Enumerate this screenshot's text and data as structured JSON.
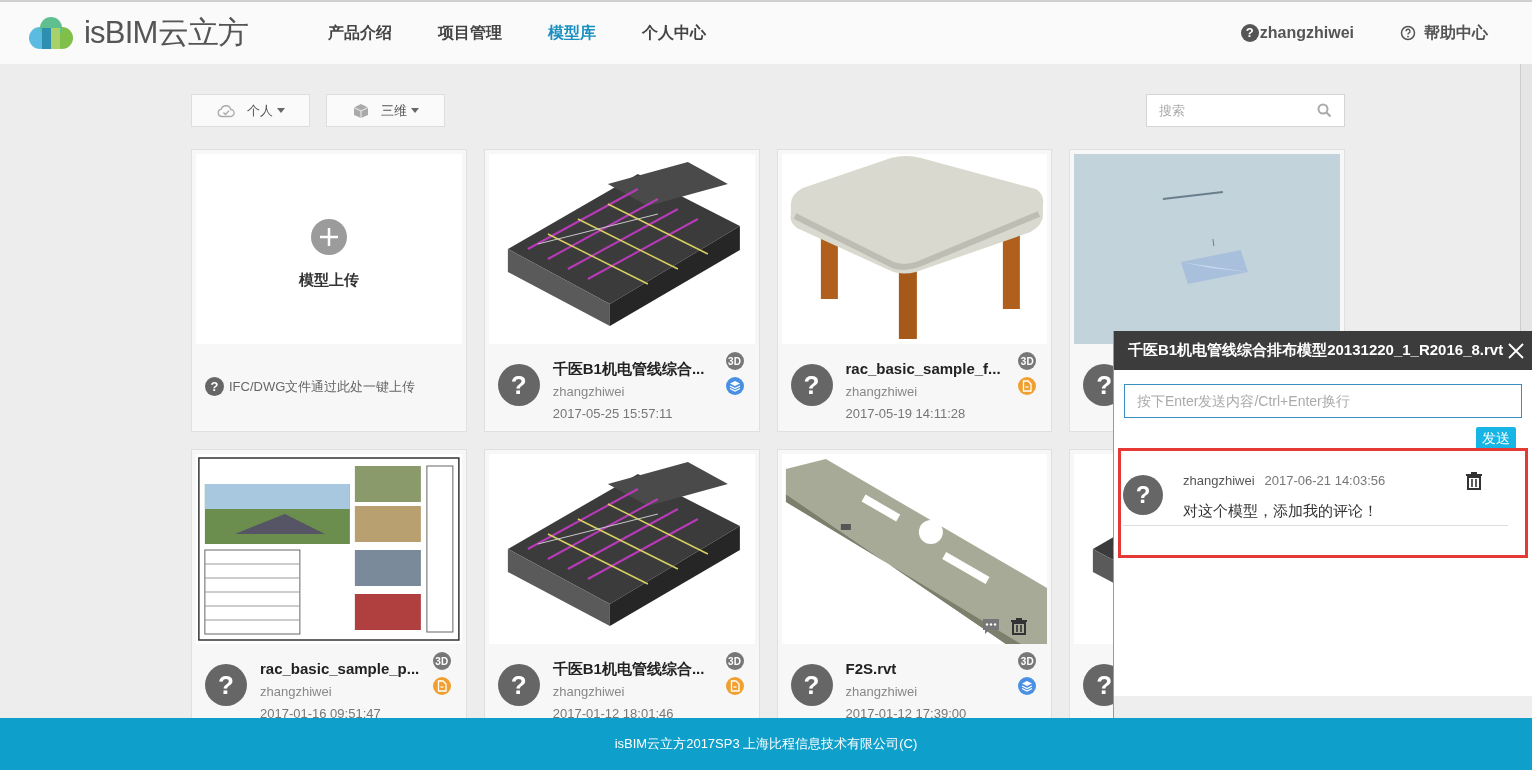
{
  "header": {
    "logo_text": "isBIM云立方",
    "nav": [
      {
        "label": "产品介绍",
        "selected": false
      },
      {
        "label": "项目管理",
        "selected": false
      },
      {
        "label": "模型库",
        "selected": true
      },
      {
        "label": "个人中心",
        "selected": false
      }
    ],
    "user_icon": "?",
    "user": "zhangzhiwei",
    "help": "帮助中心"
  },
  "toolbar": {
    "filters": [
      {
        "label": "个人",
        "kind": "cloud"
      },
      {
        "label": "三维",
        "kind": "cube"
      }
    ],
    "search": {
      "placeholder": "搜索"
    }
  },
  "upload_card": {
    "label": "模型上传",
    "hint_icon": "?",
    "hint": "IFC/DWG文件通过此处一键上传"
  },
  "models": [
    {
      "kind": "model",
      "avatar": "?",
      "title": "千医B1机电管线综合...",
      "user": "zhangzhiwei",
      "date": "2017-05-25 15:57:11",
      "badge": "3D",
      "format": {
        "kind": "layers"
      },
      "hovered": false
    },
    {
      "kind": "model",
      "avatar": "?",
      "title": "rac_basic_sample_f...",
      "user": "zhangzhiwei",
      "date": "2017-05-19 14:11:28",
      "badge": "3D",
      "format": {
        "kind": "document"
      },
      "hovered": false
    },
    {
      "kind": "partial",
      "avatar": "?"
    },
    {
      "kind": "model",
      "avatar": "?",
      "title": "rac_basic_sample_p...",
      "user": "zhangzhiwei",
      "date": "2017-01-16 09:51:47",
      "badge": "3D",
      "format": {
        "kind": "document"
      },
      "hovered": false
    },
    {
      "kind": "model",
      "avatar": "?",
      "title": "千医B1机电管线综合...",
      "user": "zhangzhiwei",
      "date": "2017-01-12 18:01:46",
      "badge": "3D",
      "format": {
        "kind": "document"
      },
      "hovered": false
    },
    {
      "kind": "model",
      "avatar": "?",
      "title": "F2S.rvt",
      "user": "zhangzhiwei",
      "date": "2017-01-12 17:39:00",
      "badge": "3D",
      "format": {
        "kind": "layers"
      },
      "hovered": true
    },
    {
      "kind": "partial",
      "avatar": "?"
    }
  ],
  "comment_panel": {
    "title": "千医B1机电管线综合排布模型20131220_1_R2016_8.rvt",
    "input": {
      "placeholder": "按下Enter发送内容/Ctrl+Enter换行"
    },
    "send": "发送",
    "comments": [
      {
        "avatar": "?",
        "user": "zhangzhiwei",
        "time": "2017-06-21 14:03:56",
        "text": "对这个模型，添加我的评论！",
        "highlighted": true
      }
    ]
  },
  "footer": "isBIM云立方2017SP3 上海比程信息技术有限公司(C)"
}
